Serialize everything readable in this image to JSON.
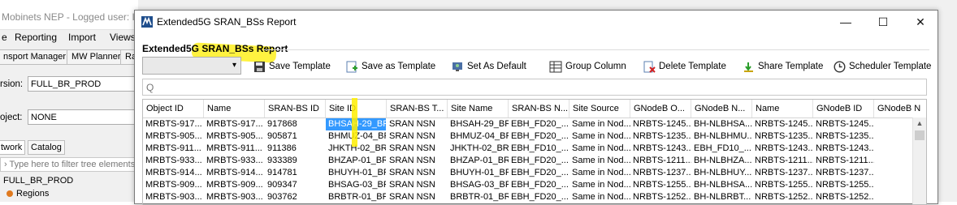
{
  "background_app": {
    "title": "Mobinets NEP - Logged user: In",
    "menu": [
      "e",
      "Reporting",
      "Import",
      "Views"
    ],
    "toolbar_tabs": [
      "nsport Manager",
      "MW Planner",
      "Ra"
    ],
    "version_label": "rsion:",
    "version_value": "FULL_BR_PROD",
    "project_label": "oject:",
    "project_value": "NONE",
    "subtabs": [
      "twork",
      "Catalog"
    ],
    "filter_placeholder": "Type here to filter tree elements",
    "tree": [
      "FULL_BR_PROD",
      "Regions"
    ]
  },
  "window": {
    "title": "Extended5G SRAN_BSs Report",
    "controls": {
      "minimize": "—",
      "maximize": "☐",
      "close": "✕"
    }
  },
  "report_heading": "Extended5G SRAN_BSs Report",
  "template_select_value": "",
  "toolbar": [
    {
      "label": "Save Template",
      "icon": "save-icon"
    },
    {
      "label": "Save as Template",
      "icon": "save-as-icon"
    },
    {
      "label": "Set As Default",
      "icon": "set-default-icon"
    },
    {
      "label": "Group Column",
      "icon": "group-column-icon"
    },
    {
      "label": "Delete Template",
      "icon": "delete-icon"
    },
    {
      "label": "Share Template",
      "icon": "share-icon"
    },
    {
      "label": "Scheduler Template",
      "icon": "clock-icon"
    }
  ],
  "search": {
    "icon": "search-icon",
    "glyph": "Q"
  },
  "table": {
    "columns": [
      "Object ID",
      "Name",
      "SRAN-BS ID",
      "Site ID",
      "SRAN-BS T...",
      "Site Name",
      "SRAN-BS N...",
      "Site Source",
      "GNodeB O...",
      "GNodeB N...",
      "Name",
      "GNodeB ID",
      "GNodeB N"
    ],
    "rows": [
      [
        "MRBTS-917...",
        "MRBTS-917...",
        "917868",
        "BHSAH-29_BR",
        "SRAN NSN",
        "BHSAH-29_BR",
        "EBH_FD20_...",
        "Same in Nod...",
        "NRBTS-1245...",
        "BH-NLBHSA...",
        "NRBTS-1245...",
        "NRBTS-1245...",
        ""
      ],
      [
        "MRBTS-905...",
        "MRBTS-905...",
        "905871",
        "BHMUZ-04_BR",
        "SRAN NSN",
        "BHMUZ-04_BR",
        "EBH_FD20_...",
        "Same in Nod...",
        "NRBTS-1235...",
        "BH-NLBHMU...",
        "NRBTS-1235...",
        "NRBTS-1235...",
        ""
      ],
      [
        "MRBTS-911...",
        "MRBTS-911...",
        "911386",
        "JHKTH-02_BR",
        "SRAN NSN",
        "JHKTH-02_BR",
        "EBH_FD10_...",
        "Same in Nod...",
        "NRBTS-1243...",
        "EBH_FD10_...",
        "NRBTS-1243...",
        "NRBTS-1243...",
        ""
      ],
      [
        "MRBTS-933...",
        "MRBTS-933...",
        "933389",
        "BHZAP-01_BR",
        "SRAN NSN",
        "BHZAP-01_BR",
        "EBH_FD20_...",
        "Same in Nod...",
        "NRBTS-1211...",
        "BH-NLBHZA...",
        "NRBTS-1211...",
        "NRBTS-1211...",
        ""
      ],
      [
        "MRBTS-914...",
        "MRBTS-914...",
        "914781",
        "BHUYH-01_BR",
        "SRAN NSN",
        "BHUYH-01_BR",
        "EBH_FD20_...",
        "Same in Nod...",
        "NRBTS-1237...",
        "BH-NLBHUY...",
        "NRBTS-1237...",
        "NRBTS-1237...",
        ""
      ],
      [
        "MRBTS-909...",
        "MRBTS-909...",
        "909347",
        "BHSAG-03_BR",
        "SRAN NSN",
        "BHSAG-03_BR",
        "EBH_FD20_...",
        "Same in Nod...",
        "NRBTS-1255...",
        "BH-NLBHSA...",
        "NRBTS-1255...",
        "NRBTS-1255...",
        ""
      ],
      [
        "MRBTS-903...",
        "MRBTS-903...",
        "903762",
        "BRBTR-01_BR",
        "SRAN NSN",
        "BRBTR-01_BR",
        "EBH_FD20_...",
        "Same in Nod...",
        "NRBTS-1252...",
        "BH-NLBRBT...",
        "NRBTS-1252...",
        "NRBTS-1252...",
        ""
      ]
    ],
    "selected": {
      "row": 0,
      "col": 3
    }
  },
  "colors": {
    "selection": "#3399ff",
    "highlight": "#ffee00"
  }
}
